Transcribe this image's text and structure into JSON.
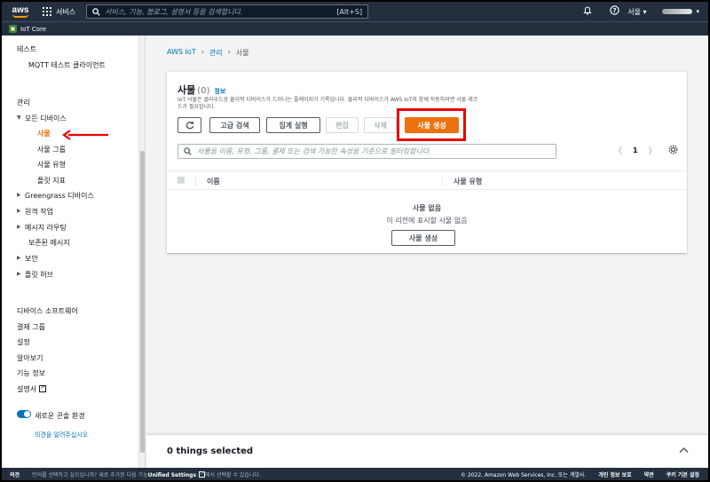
{
  "topnav": {
    "logo": "aws",
    "services_label": "서비스",
    "search_placeholder": "서비스, 기능, 블로그, 설명서 등을 검색합니다.",
    "search_shortcut": "[Alt+S]",
    "bell_icon": "bell-icon",
    "help_icon": "question-circle-icon",
    "region": "서울 ▾",
    "account_caret": "▾"
  },
  "service_bar": {
    "label": "IoT Core",
    "badge_color": "#3f8624"
  },
  "sidebar": {
    "test_header": "테스트",
    "mqtt_client": "MQTT 테스트 클라이언트",
    "manage_header": "관리",
    "all_devices": "모든 디바이스",
    "things": "사물",
    "thing_groups": "사물 그룹",
    "thing_types": "사물 유형",
    "fleet_metrics": "플릿 지표",
    "greengrass": "Greengrass 디바이스",
    "remote_ops": "원격 작업",
    "message_routing": "메시지 라우팅",
    "retained_messages": "보존된 메시지",
    "security": "보안",
    "fleet_hub": "플릿 허브",
    "device_software": "디바이스 소프트웨어",
    "billing_groups": "결제 그룹",
    "settings": "설정",
    "learn": "알아보기",
    "feature_spotlight": "기능 정보",
    "documentation": "설명서",
    "new_console": "새로운 콘솔 환경",
    "feedback_link": "의견을 알려주십시오",
    "active_color": "#ec7211"
  },
  "breadcrumb": {
    "root": "AWS IoT",
    "mid": "관리",
    "current": "사물"
  },
  "things_panel": {
    "title": "사물",
    "count": "(0)",
    "info": "정보",
    "description": "IoT 사물은 클라우드상 물리적 디바이스가 드러나는 플레이지가 기록입니다. 물리적 디바이스가 AWS IoT와 함께 작동하려면 사물 레코드가 필요합니다.",
    "refresh_icon": "refresh-icon",
    "advanced_search": "고급 검색",
    "run_aggregation": "집계 실행",
    "edit": "편집",
    "delete": "삭제",
    "create_things": "사물 생성",
    "filter_placeholder": "사물을 이름, 유형, 그룹, 결제 또는 검색 가능한 속성을 기준으로 필터링합니다.",
    "page": "1",
    "prev": "〈",
    "next": "〉",
    "settings_icon": "gear-icon",
    "col_name": "이름",
    "col_type": "사물 유형",
    "empty_title": "사물 없음",
    "empty_sub": "이 리전에 표시할 사물 없음",
    "empty_create": "사물 생성",
    "primary_color": "#ec7211",
    "highlight_color": "#e00000"
  },
  "split_panel": {
    "title": "0 things selected",
    "caret": "^"
  },
  "footer": {
    "feedback": "의견",
    "message_pre": "언어를 선택하고 싶으십니까? 새로 추가된 다음 기능",
    "message_bold": "Unified Settings",
    "message_post": "에서 선택할 수 있습니다.",
    "copyright": "© 2022, Amazon Web Services, Inc. 또는 계열사.",
    "privacy": "개인 정보 보호",
    "terms": "약관",
    "cookies": "쿠키 기본 설정"
  }
}
